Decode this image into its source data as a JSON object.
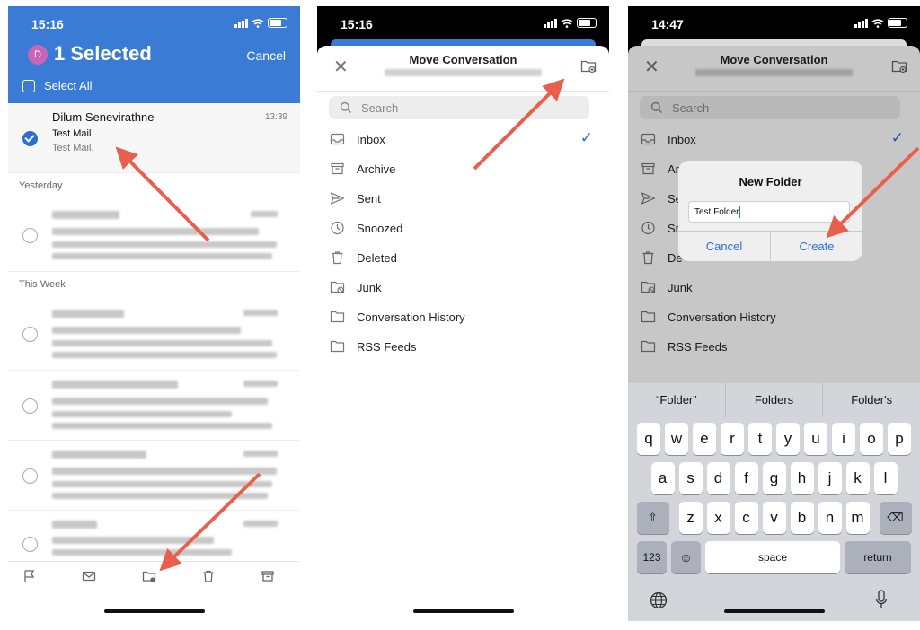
{
  "phone1": {
    "status_time": "15:16",
    "header": {
      "avatar": "D",
      "title": "1 Selected",
      "cancel": "Cancel",
      "select_all": "Select All"
    },
    "selected_mail": {
      "sender": "Dilum Senevirathne",
      "time": "13:39",
      "subject": "Test Mail",
      "preview": "Test Mail."
    },
    "sections": {
      "yesterday": "Yesterday",
      "this_week": "This Week"
    },
    "toolbar_icons": [
      "flag-icon",
      "envelope-icon",
      "folder-move-icon",
      "trash-icon",
      "archive-icon"
    ]
  },
  "phone2": {
    "status_time": "15:16",
    "title": "Move Conversation",
    "search_placeholder": "Search",
    "folders": [
      {
        "label": "Inbox",
        "icon": "inbox-icon",
        "checked": true
      },
      {
        "label": "Archive",
        "icon": "archive-icon"
      },
      {
        "label": "Sent",
        "icon": "send-icon"
      },
      {
        "label": "Snoozed",
        "icon": "clock-icon"
      },
      {
        "label": "Deleted",
        "icon": "trash-icon"
      },
      {
        "label": "Junk",
        "icon": "junk-folder-icon"
      },
      {
        "label": "Conversation History",
        "icon": "folder-icon"
      },
      {
        "label": "RSS Feeds",
        "icon": "folder-icon"
      }
    ]
  },
  "phone3": {
    "status_time": "14:47",
    "title": "Move Conversation",
    "search_placeholder": "Search",
    "folders_partial": [
      "Ar",
      "Se",
      "Sn",
      "De"
    ],
    "dialog": {
      "title": "New Folder",
      "value": "Test Folder",
      "cancel": "Cancel",
      "create": "Create"
    },
    "suggestions": [
      "“Folder”",
      "Folders",
      "Folder's"
    ],
    "keys_row1": [
      "q",
      "w",
      "e",
      "r",
      "t",
      "y",
      "u",
      "i",
      "o",
      "p"
    ],
    "keys_row2": [
      "a",
      "s",
      "d",
      "f",
      "g",
      "h",
      "j",
      "k",
      "l"
    ],
    "keys_row3": [
      "z",
      "x",
      "c",
      "v",
      "b",
      "n",
      "m"
    ],
    "key_123": "123",
    "key_space": "space",
    "key_return": "return"
  },
  "colors": {
    "accent": "#3a7bd5",
    "link": "#2b6fd1",
    "arrow": "#e8604c"
  }
}
